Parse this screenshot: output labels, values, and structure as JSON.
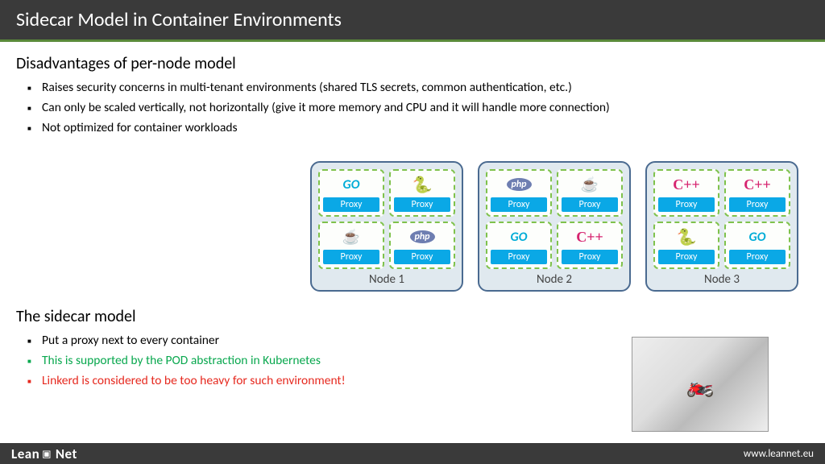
{
  "title": "Sidecar Model in Container Environments",
  "disadvantages": {
    "heading": "Disadvantages of per-node model",
    "items": [
      "Raises security concerns in multi-tenant environments (shared TLS secrets, common authentication, etc.)",
      "Can only be scaled vertically, not horizontally (give it more memory and CPU and it will handle more connection)",
      "Not optimized for container workloads"
    ]
  },
  "sidecar": {
    "heading": "The sidecar model",
    "items": [
      {
        "text": "Put a proxy next to every container",
        "color": "black"
      },
      {
        "text": "This is supported by the POD abstraction in Kubernetes",
        "color": "green"
      },
      {
        "text": "Linkerd is considered to be too heavy for such environment!",
        "color": "red"
      }
    ]
  },
  "proxy_label": "Proxy",
  "nodes": [
    {
      "label": "Node 1",
      "pods": [
        "go",
        "python",
        "java",
        "php"
      ]
    },
    {
      "label": "Node 2",
      "pods": [
        "php",
        "java",
        "go",
        "cpp"
      ]
    },
    {
      "label": "Node 3",
      "pods": [
        "cpp",
        "cpp",
        "python",
        "go"
      ]
    }
  ],
  "icon_text": {
    "go": "GO",
    "cpp": "C++",
    "php": "php"
  },
  "footer": {
    "brand_left": "Lean",
    "brand_right": "Net",
    "url": "www.leannet.eu"
  }
}
